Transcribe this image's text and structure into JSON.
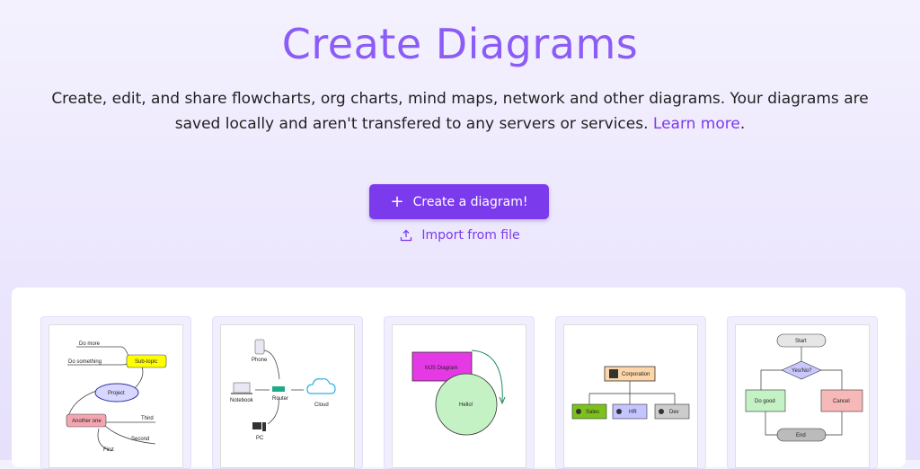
{
  "header": {
    "title": "Create Diagrams",
    "description": "Create, edit, and share flowcharts, org charts, mind maps, network and other diagrams. Your diagrams are saved locally and aren't transfered to any servers or services. ",
    "learn_more": "Learn more",
    "period": "."
  },
  "actions": {
    "create_label": "Create a diagram!",
    "import_label": "Import from file"
  },
  "templates": {
    "mindmap": {
      "labels": [
        "Do more",
        "Do something",
        "Sub-topic",
        "Project",
        "Another one",
        "Third",
        "Second",
        "First"
      ]
    },
    "network": {
      "labels": [
        "Phone",
        "Notebook",
        "Router",
        "Cloud",
        "PC"
      ]
    },
    "simple": {
      "labels": [
        "MJS Diagram",
        "Hello!"
      ]
    },
    "org": {
      "labels": [
        "Corporation",
        "Sales",
        "HR",
        "Dev"
      ]
    },
    "flowchart": {
      "labels": [
        "Start",
        "Yes/No?",
        "Do good",
        "Cancel",
        "End"
      ]
    }
  },
  "colors": {
    "accent": "#7c3aed",
    "title": "#8b5cf6"
  }
}
